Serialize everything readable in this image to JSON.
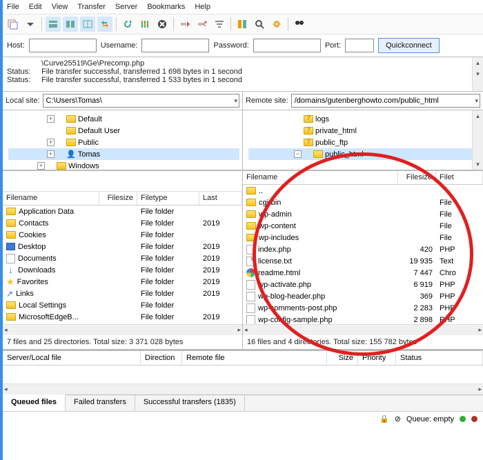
{
  "menu": [
    "File",
    "Edit",
    "View",
    "Transfer",
    "Server",
    "Bookmarks",
    "Help"
  ],
  "conn": {
    "host": "Host:",
    "user": "Username:",
    "pass": "Password:",
    "port": "Port:",
    "qc": "Quickconnect"
  },
  "log": {
    "l0": "\\Curve25519\\Ge\\Precomp.php",
    "s1": "Status:",
    "t1": "File transfer successful, transferred 1 698 bytes in 1 second",
    "s2": "Status:",
    "t2": "File transfer successful, transferred 1 533 bytes in 1 second"
  },
  "local": {
    "label": "Local site:",
    "path": "C:\\Users\\Tomas\\",
    "tree": [
      "Default",
      "Default User",
      "Public",
      "Tomas",
      "Windows"
    ],
    "cols": [
      "Filename",
      "Filesize",
      "Filetype",
      "Last"
    ],
    "rows": [
      {
        "n": "Application Data",
        "t": "File folder",
        "d": "",
        "i": "folder"
      },
      {
        "n": "Contacts",
        "t": "File folder",
        "d": "2019",
        "i": "folder"
      },
      {
        "n": "Cookies",
        "t": "File folder",
        "d": "",
        "i": "folder"
      },
      {
        "n": "Desktop",
        "t": "File folder",
        "d": "2019",
        "i": "desk"
      },
      {
        "n": "Documents",
        "t": "File folder",
        "d": "2019",
        "i": "docs"
      },
      {
        "n": "Downloads",
        "t": "File folder",
        "d": "2019",
        "i": "dl"
      },
      {
        "n": "Favorites",
        "t": "File folder",
        "d": "2019",
        "i": "star"
      },
      {
        "n": "Links",
        "t": "File folder",
        "d": "2019",
        "i": "link"
      },
      {
        "n": "Local Settings",
        "t": "File folder",
        "d": "",
        "i": "folder"
      },
      {
        "n": "MicrosoftEdgeB...",
        "t": "File folder",
        "d": "2019",
        "i": "folder"
      }
    ],
    "status": "7 files and 25 directories. Total size: 3 371 028 bytes"
  },
  "remote": {
    "label": "Remote site:",
    "path": "/domains/gutenberghowto.com/public_html",
    "tree": [
      "logs",
      "private_html",
      "public_ftp",
      "public_html"
    ],
    "cols": [
      "Filename",
      "Filesize",
      "Filet"
    ],
    "rows": [
      {
        "n": "..",
        "s": "",
        "t": "",
        "i": "folder"
      },
      {
        "n": "cgi-bin",
        "s": "",
        "t": "File",
        "i": "folder"
      },
      {
        "n": "wp-admin",
        "s": "",
        "t": "File",
        "i": "folder"
      },
      {
        "n": "wp-content",
        "s": "",
        "t": "File",
        "i": "folder"
      },
      {
        "n": "wp-includes",
        "s": "",
        "t": "File",
        "i": "folder"
      },
      {
        "n": "index.php",
        "s": "420",
        "t": "PHP",
        "i": "php"
      },
      {
        "n": "license.txt",
        "s": "19 935",
        "t": "Text",
        "i": "file"
      },
      {
        "n": "readme.html",
        "s": "7 447",
        "t": "Chro",
        "i": "html"
      },
      {
        "n": "wp-activate.php",
        "s": "6 919",
        "t": "PHP",
        "i": "php"
      },
      {
        "n": "wp-blog-header.php",
        "s": "369",
        "t": "PHP",
        "i": "php"
      },
      {
        "n": "wp-comments-post.php",
        "s": "2 283",
        "t": "PHP",
        "i": "php"
      },
      {
        "n": "wp-config-sample.php",
        "s": "2 898",
        "t": "PHP",
        "i": "php"
      }
    ],
    "status": "16 files and 4 directories. Total size: 155 782 bytes"
  },
  "xfer": {
    "cols": [
      "Server/Local file",
      "Direction",
      "Remote file",
      "Size",
      "Priority",
      "Status"
    ]
  },
  "tabs": {
    "q": "Queued files",
    "f": "Failed transfers",
    "s": "Successful transfers (1835)"
  },
  "bottom": {
    "q": "Queue: empty"
  }
}
